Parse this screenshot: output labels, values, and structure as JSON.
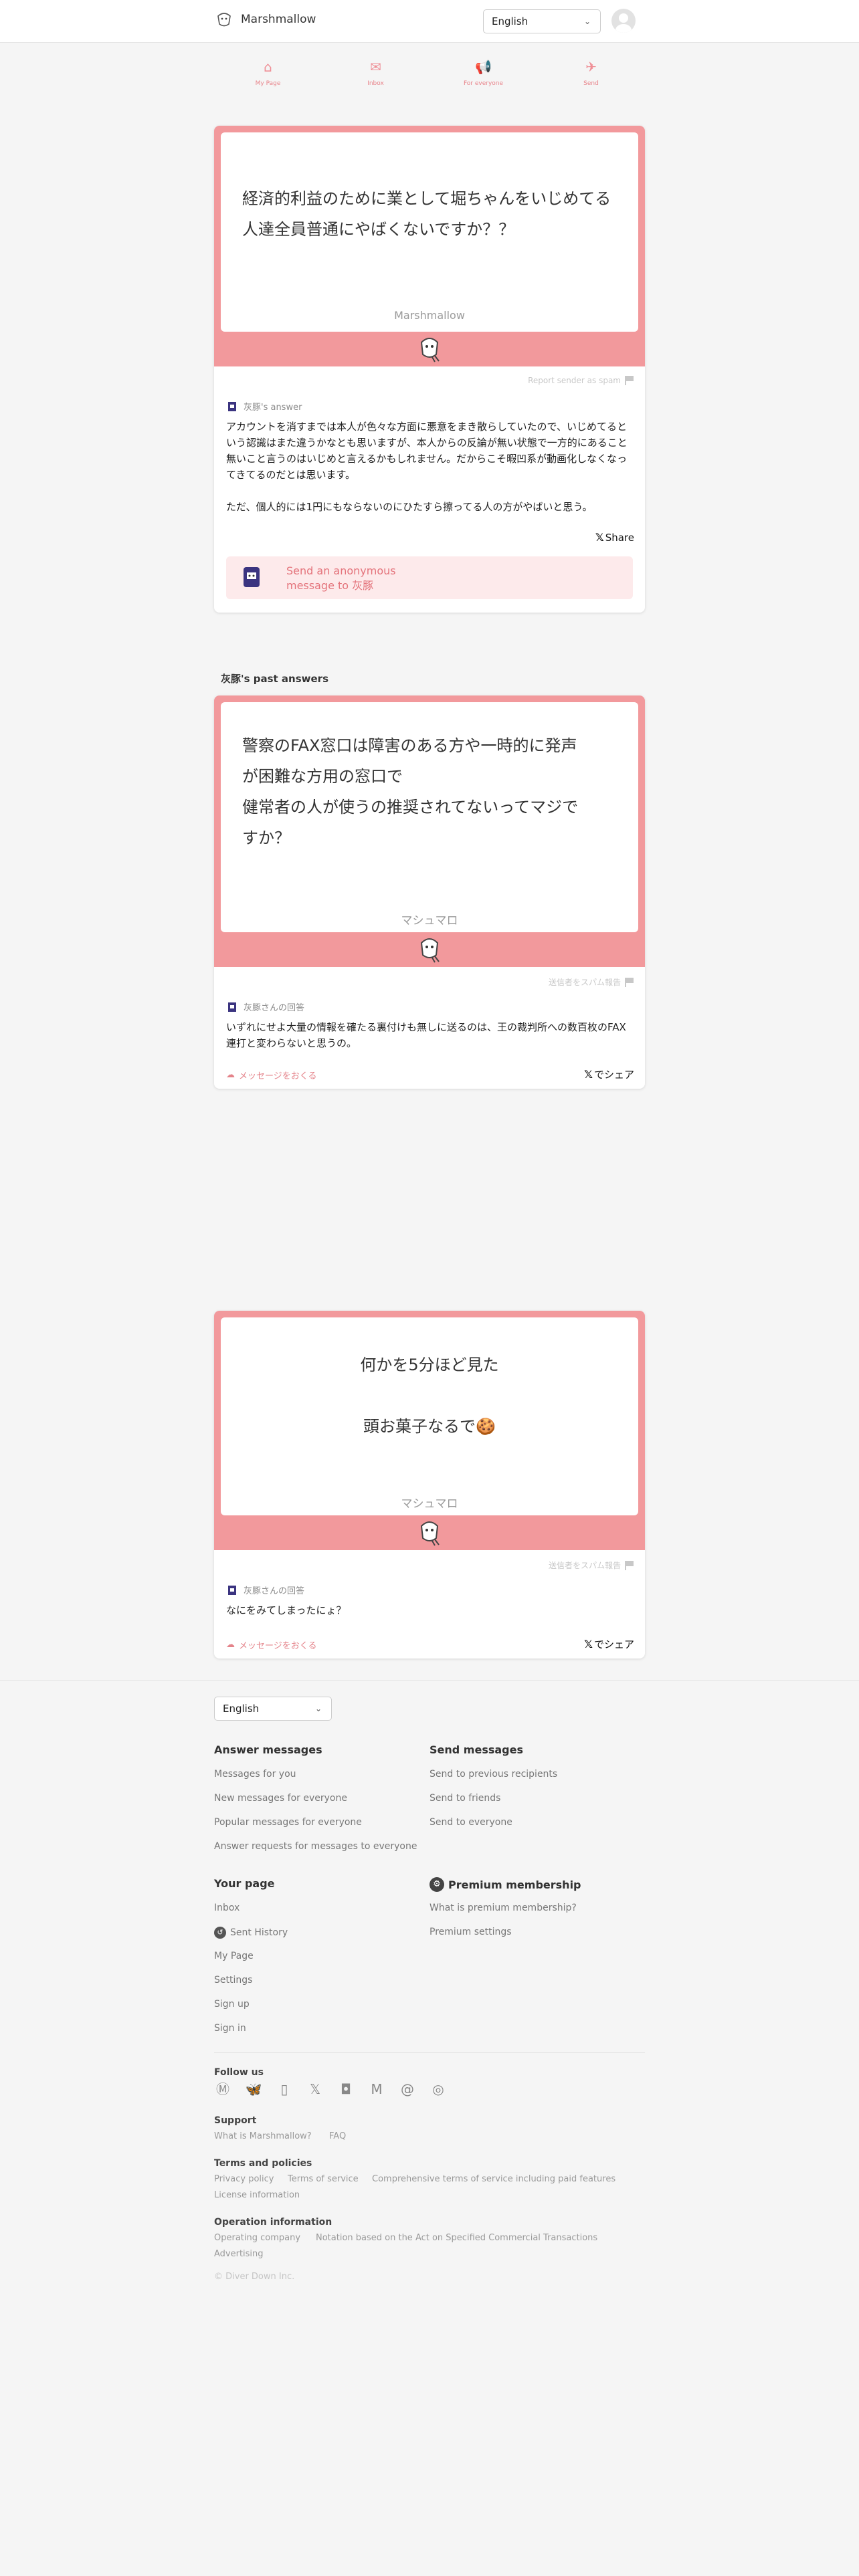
{
  "header": {
    "app_name": "Marshmallow",
    "language": "English"
  },
  "nav": [
    {
      "label": "My Page",
      "icon": "home-icon"
    },
    {
      "label": "Inbox",
      "icon": "inbox-icon"
    },
    {
      "label": "For everyone",
      "icon": "megaphone-icon"
    },
    {
      "label": "Send",
      "icon": "paper-plane-icon"
    }
  ],
  "main_card": {
    "question": "経済的利益のために業として堀ちゃんをいじめてる人達全員普通にやばくないですか？？",
    "brand": "Marshmallow",
    "report": "Report sender as spam",
    "answerer": "灰豚's answer",
    "answer_p1": "アカウントを消すまでは本人が色々な方面に悪意をまき散らしていたので、いじめてるという認識はまた違うかなとも思いますが、本人からの反論が無い状態で一方的にあること無いこと言うのはいじめと言えるかもしれません。だからこそ暇凹系が動画化しなくなってきてるのだとは思います。",
    "answer_p2": "ただ、個人的には1円にもならないのにひたすら擦ってる人の方がやばいと思う。",
    "share": "Share",
    "send_line1": "Send an anonymous",
    "send_line2": "message to 灰豚"
  },
  "past_title": "灰豚's past answers",
  "past": [
    {
      "question_lines": [
        "警察のFAX窓口は障害のある方や一時的に発声",
        "が困難な方用の窓口で",
        "健常者の人が使うの推奨されてないってマジで",
        "すか？"
      ],
      "brand": "マシュマロ",
      "report": "送信者をスパム報告",
      "answerer": "灰豚さんの回答",
      "answer": "いずれにせよ大量の情報を確たる裏付けも無しに送るのは、王の裁判所への数百枚のFAX連打と変わらないと思うの。",
      "message_link": "メッセージをおくる",
      "share": "でシェア"
    },
    {
      "question_lines": [
        "何かを5分ほど見た",
        "頭お菓子なるで🍪"
      ],
      "brand": "マシュマロ",
      "report": "送信者をスパム報告",
      "answerer": "灰豚さんの回答",
      "answer": "なにをみてしまったにょ？",
      "message_link": "メッセージをおくる",
      "share": "でシェア"
    }
  ],
  "footer": {
    "language": "English",
    "answer_messages": {
      "title": "Answer messages",
      "links": [
        "Messages for you",
        "New messages for everyone",
        "Popular messages for everyone",
        "Answer requests for messages to everyone"
      ]
    },
    "send_messages": {
      "title": "Send messages",
      "links": [
        "Send to previous recipients",
        "Send to friends",
        "Send to everyone"
      ]
    },
    "your_page": {
      "title": "Your page",
      "links": [
        "Inbox",
        "Sent History",
        "My Page",
        "Settings",
        "Sign up",
        "Sign in"
      ]
    },
    "premium": {
      "title": "Premium membership",
      "links": [
        "What is premium membership?",
        "Premium settings"
      ]
    },
    "follow_us": "Follow us",
    "support": {
      "title": "Support",
      "links": [
        "What is Marshmallow?",
        "FAQ"
      ]
    },
    "terms": {
      "title": "Terms and policies",
      "links": [
        "Privacy policy",
        "Terms of service",
        "Comprehensive terms of service including paid features",
        "License information"
      ]
    },
    "operation": {
      "title": "Operation information",
      "links": [
        "Operating company",
        "Notation based on the Act on Specified Commercial Transactions",
        "Advertising"
      ]
    },
    "copyright": "© Diver Down Inc."
  },
  "colors": {
    "accent": "#f2999c",
    "link_pink": "#e4737b"
  }
}
